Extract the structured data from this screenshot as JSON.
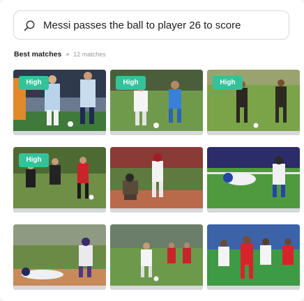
{
  "search": {
    "value": "Messi passes the ball to player 26 to score",
    "icon": "search-icon"
  },
  "results": {
    "title": "Best matches",
    "count": "12 matches"
  },
  "tiles": [
    {
      "badge": "High"
    },
    {
      "badge": "High"
    },
    {
      "badge": "High"
    },
    {
      "badge": "High"
    },
    {
      "badge": ""
    },
    {
      "badge": ""
    },
    {
      "badge": ""
    },
    {
      "badge": ""
    },
    {
      "badge": ""
    }
  ],
  "colors": {
    "badge": "#34c29a",
    "accent_text": "#1c1c1f",
    "muted_text": "#9a9aa1"
  }
}
